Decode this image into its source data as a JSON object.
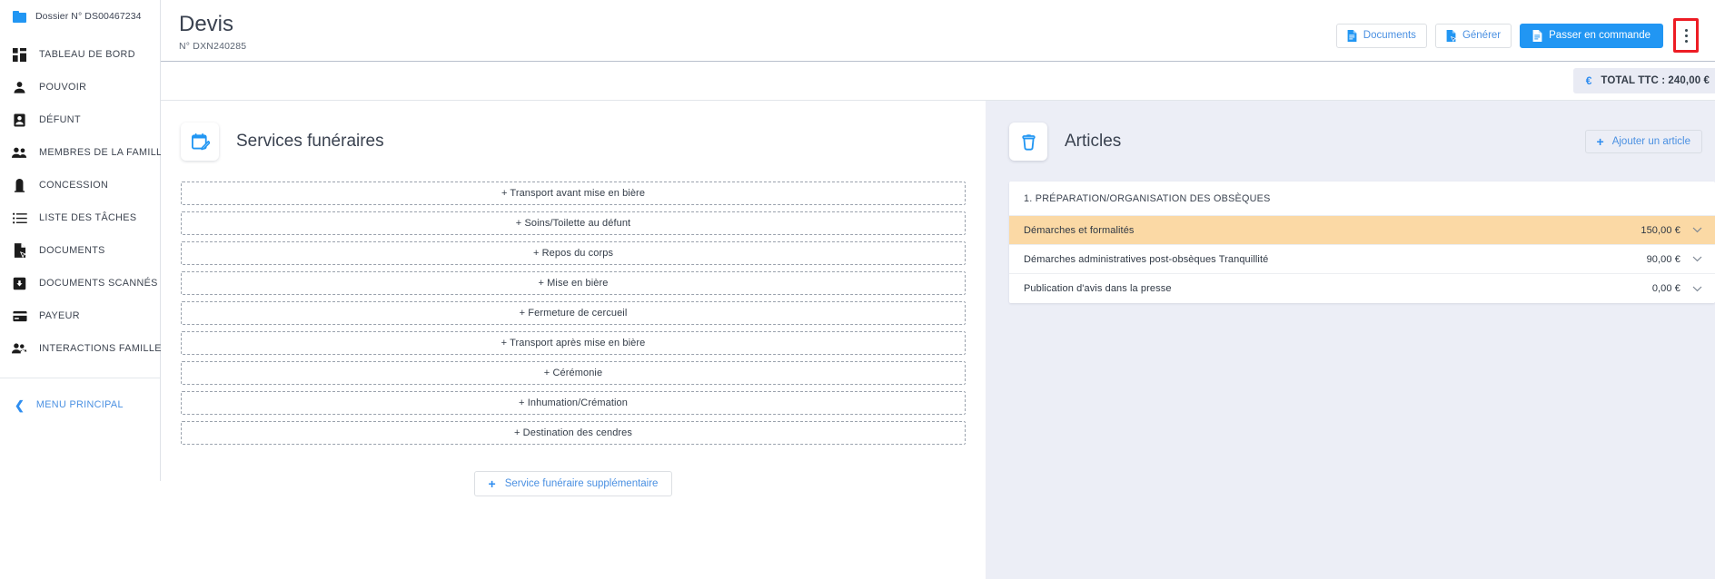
{
  "sidebar": {
    "folder": {
      "label": "Dossier N° DS00467234",
      "icon": "folder-icon"
    },
    "items": [
      {
        "label": "TABLEAU DE BORD",
        "icon": "dashboard-icon"
      },
      {
        "label": "POUVOIR",
        "icon": "person-icon"
      },
      {
        "label": "DÉFUNT",
        "icon": "id-badge-icon"
      },
      {
        "label": "MEMBRES DE LA FAMILLE",
        "icon": "people-icon"
      },
      {
        "label": "CONCESSION",
        "icon": "headstone-icon"
      },
      {
        "label": "LISTE DES TÂCHES",
        "icon": "list-icon"
      },
      {
        "label": "DOCUMENTS",
        "icon": "document-cursor-icon"
      },
      {
        "label": "DOCUMENTS SCANNÉS",
        "icon": "download-box-icon"
      },
      {
        "label": "PAYEUR",
        "icon": "credit-card-icon"
      },
      {
        "label": "INTERACTIONS FAMILLE",
        "icon": "people-arrow-icon"
      }
    ],
    "menu_principal": {
      "label": "MENU PRINCIPAL",
      "icon": "chevron-left-icon"
    }
  },
  "header": {
    "title": "Devis",
    "reference": "N° DXN240285",
    "buttons": [
      {
        "label": "Documents",
        "icon": "document-icon",
        "style": "outline"
      },
      {
        "label": "Générer",
        "icon": "document-cursor-icon",
        "style": "outline"
      },
      {
        "label": "Passer en commande",
        "icon": "document-icon",
        "style": "primary"
      }
    ],
    "overflow_menu": {
      "name": "more-options",
      "icon": "kebab-menu-icon",
      "highlight_color": "#ed1c24"
    }
  },
  "total_bar": {
    "icon": "euro-icon",
    "label": "TOTAL TTC : 240,00 €"
  },
  "services_panel": {
    "icon": "calendar-edit-icon",
    "title": "Services funéraires",
    "items": [
      "+ Transport avant mise en bière",
      "+ Soins/Toilette au défunt",
      "+ Repos du corps",
      "+ Mise en bière",
      "+ Fermeture de cercueil",
      "+ Transport après mise en bière",
      "+ Cérémonie",
      "+ Inhumation/Crémation",
      "+ Destination des cendres"
    ],
    "extra_button": {
      "label": "Service funéraire supplémentaire",
      "icon": "plus-icon"
    }
  },
  "articles_panel": {
    "icon": "urn-icon",
    "title": "Articles",
    "add_button": {
      "label": "Ajouter un article",
      "icon": "plus-icon"
    },
    "groups": [
      {
        "title": "1. PRÉPARATION/ORGANISATION DES OBSÈQUES",
        "rows": [
          {
            "name": "Démarches et formalités",
            "price": "150,00 €",
            "highlighted": true
          },
          {
            "name": "Démarches administratives post-obsèques Tranquillité",
            "price": "90,00 €",
            "highlighted": false
          },
          {
            "name": "Publication d'avis dans la presse",
            "price": "0,00 €",
            "highlighted": false
          }
        ]
      }
    ]
  },
  "colors": {
    "accent_blue": "#2196f3",
    "link_blue": "#4a90e2",
    "highlight_row": "#fbd9a5",
    "right_panel_bg": "#eceef6",
    "highlight_border": "#ed1c24"
  }
}
